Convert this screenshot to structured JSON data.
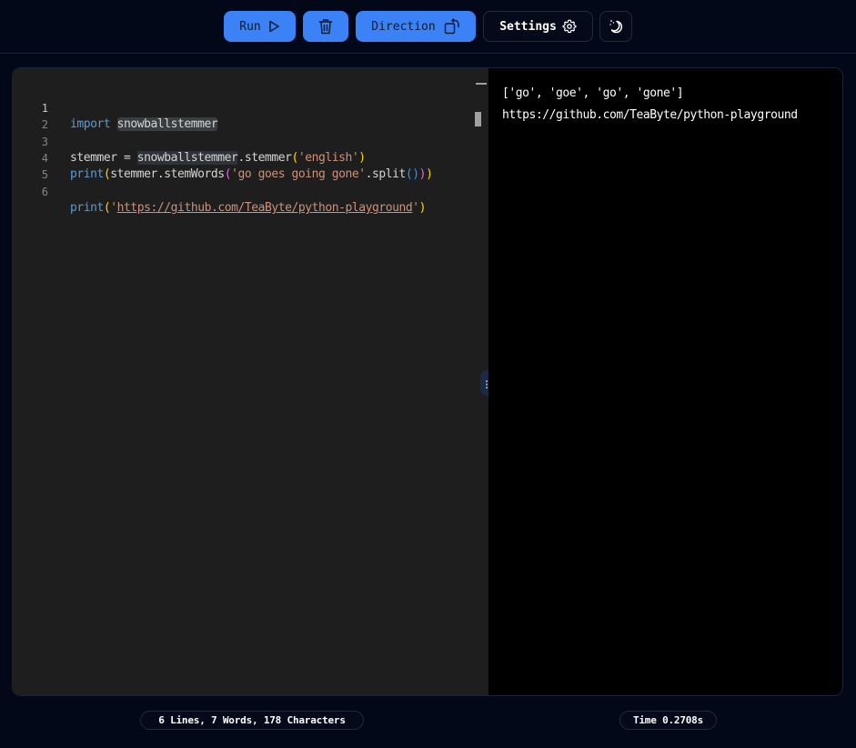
{
  "toolbar": {
    "run_label": "Run",
    "direction_label": "Direction",
    "settings_label": "Settings",
    "icons": {
      "run": "play-icon",
      "clear": "trash-icon",
      "direction": "rotate-icon",
      "settings": "gear-icon",
      "theme": "moon-stars-icon"
    },
    "accent_color": "#3b82f6"
  },
  "editor": {
    "lines": [
      {
        "number": "1",
        "text": "import snowballstemmer"
      },
      {
        "number": "2",
        "text": ""
      },
      {
        "number": "3",
        "text": "stemmer = snowballstemmer.stemmer('english')"
      },
      {
        "number": "4",
        "text": "print(stemmer.stemWords('go goes going gone'.split()))"
      },
      {
        "number": "5",
        "text": ""
      },
      {
        "number": "6",
        "text": "print('https://github.com/TeaByte/python-playground')"
      }
    ],
    "tokens": {
      "import_kw": "import",
      "module": "snowballstemmer",
      "stemmer_var": "stemmer",
      "eq": " = ",
      "dot_stemmer": ".stemmer",
      "english_str": "'english'",
      "print": "print",
      "stem_call": "stemmer.stemWords",
      "words_str": "'go goes going gone'",
      "split": ".split",
      "url_q": "'",
      "url": "https://github.com/TeaByte/python-playground",
      "lp": "(",
      "rp": ")"
    }
  },
  "output": {
    "lines": [
      "['go', 'goe', 'go', 'gone']",
      "https://github.com/TeaByte/python-playground"
    ]
  },
  "status": {
    "stats": "6 Lines, 7 Words, 178 Characters",
    "time": "Time 0.2708s"
  }
}
